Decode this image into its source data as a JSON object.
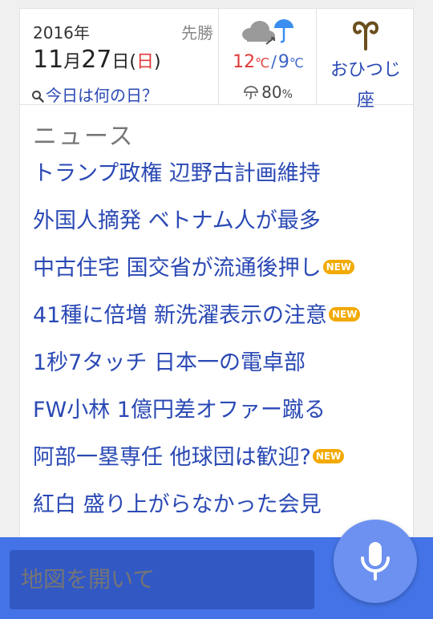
{
  "date": {
    "year": "2016年",
    "month": "11",
    "month_unit": "月",
    "day": "27",
    "day_unit": "日",
    "paren_open": "(",
    "weekday": "日",
    "paren_close": ")",
    "rokuyo": "先勝",
    "today_link": "今日は何の日？"
  },
  "weather": {
    "icon": "cloudy-then-rain-icon",
    "high": "12",
    "high_unit": "℃",
    "separator": "/",
    "low": "9",
    "low_unit": "℃",
    "rain_icon": "umbrella-icon",
    "rain_chance": "80",
    "rain_unit": "%"
  },
  "zodiac": {
    "icon": "aries-icon",
    "name": "おひつじ座"
  },
  "news": {
    "heading": "ニュース",
    "badge_label": "NEW",
    "items": [
      {
        "title": "トランプ政権 辺野古計画維持",
        "is_new": false
      },
      {
        "title": "外国人摘発 ベトナム人が最多",
        "is_new": false
      },
      {
        "title": "中古住宅 国交省が流通後押し",
        "is_new": true
      },
      {
        "title": "41種に倍増 新洗濯表示の注意",
        "is_new": true
      },
      {
        "title": "1秒7タッチ 日本一の電卓部",
        "is_new": false
      },
      {
        "title": "FW小林 1億円差オファー蹴る",
        "is_new": false
      },
      {
        "title": "阿部一塁専任 他球団は歓迎?",
        "is_new": true
      },
      {
        "title": "紅白 盛り上がらなかった会見",
        "is_new": false
      }
    ]
  },
  "search": {
    "placeholder": "地図を開いて",
    "mic_icon": "microphone-icon"
  },
  "colors": {
    "link": "#2a49b4",
    "sunday_red": "#e23a3a",
    "low_temp_blue": "#3a62c8",
    "new_badge": "#f2a900",
    "bottom_bar": "#4373e6",
    "search_box": "#3258c4",
    "mic_button": "#6d91f0"
  }
}
